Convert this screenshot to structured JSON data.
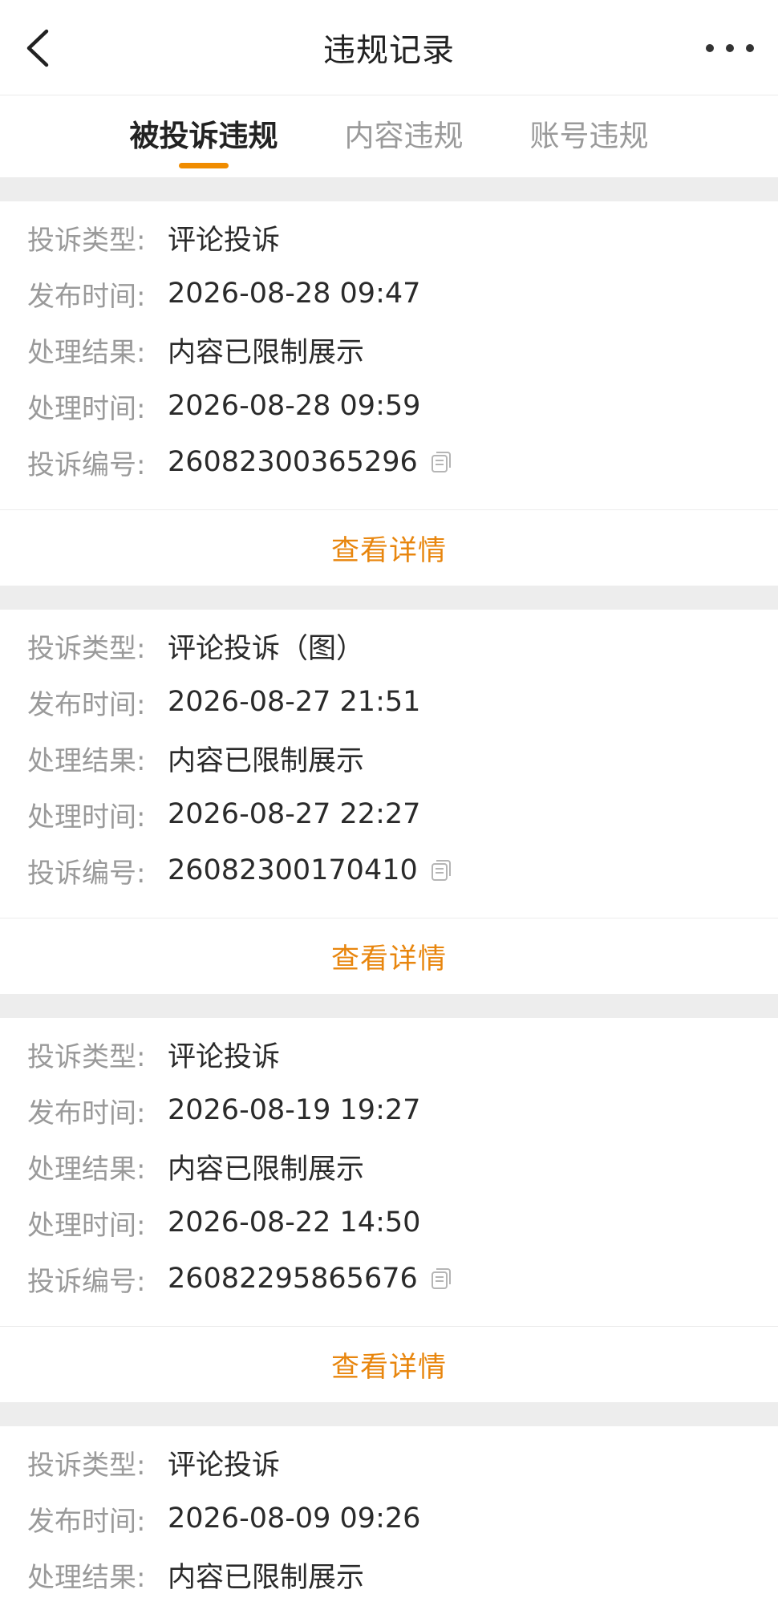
{
  "header": {
    "title": "违规记录",
    "back_icon": "chevron-left-icon",
    "more_icon": "more-horizontal-icon"
  },
  "tabs": [
    {
      "label": "被投诉违规",
      "active": true
    },
    {
      "label": "内容违规",
      "active": false
    },
    {
      "label": "账号违规",
      "active": false
    }
  ],
  "colors": {
    "accent": "#f08c00",
    "detail_text": "#e8860e",
    "label_gray": "#9a9a9a",
    "page_bg": "#ededed"
  },
  "records": [
    {
      "type_label": "投诉类型:",
      "type_value": "评论投诉",
      "publish_label": "发布时间:",
      "publish_value": "2026-08-28 09:47",
      "result_label": "处理结果:",
      "result_value": "内容已限制展示",
      "process_label": "处理时间:",
      "process_value": "2026-08-28 09:59",
      "id_label": "投诉编号:",
      "id_value": "26082300365296",
      "detail_label": "查看详情"
    },
    {
      "type_label": "投诉类型:",
      "type_value": "评论投诉（图）",
      "publish_label": "发布时间:",
      "publish_value": "2026-08-27 21:51",
      "result_label": "处理结果:",
      "result_value": "内容已限制展示",
      "process_label": "处理时间:",
      "process_value": "2026-08-27 22:27",
      "id_label": "投诉编号:",
      "id_value": "26082300170410",
      "detail_label": "查看详情"
    },
    {
      "type_label": "投诉类型:",
      "type_value": "评论投诉",
      "publish_label": "发布时间:",
      "publish_value": "2026-08-19 19:27",
      "result_label": "处理结果:",
      "result_value": "内容已限制展示",
      "process_label": "处理时间:",
      "process_value": "2026-08-22 14:50",
      "id_label": "投诉编号:",
      "id_value": "26082295865676",
      "detail_label": "查看详情"
    },
    {
      "type_label": "投诉类型:",
      "type_value": "评论投诉",
      "publish_label": "发布时间:",
      "publish_value": "2026-08-09 09:26",
      "result_label": "处理结果:",
      "result_value": "内容已限制展示"
    }
  ]
}
